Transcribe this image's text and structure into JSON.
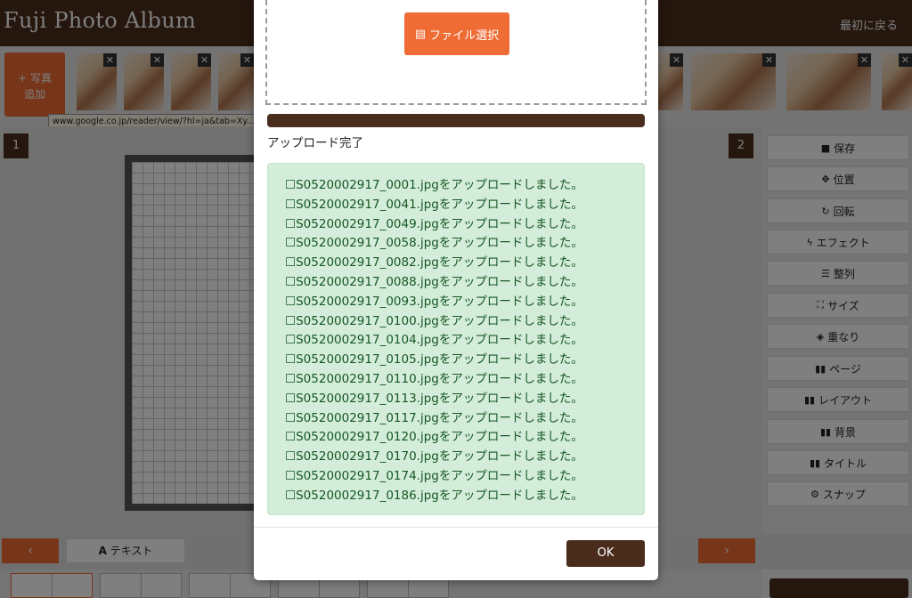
{
  "header": {
    "title": "Fuji Photo Album",
    "back_link": "最初に戻る"
  },
  "photo_strip": {
    "add_button_icon": "plus-icon",
    "add_button_line1": "写真",
    "add_button_line2": "追加",
    "tooltip": "www.google.co.jp/reader/view/?hl=ja&tab=Xy..."
  },
  "pages": {
    "left": "1",
    "right": "2"
  },
  "tools": [
    {
      "label": "保存",
      "icon": "save-icon"
    },
    {
      "label": "位置",
      "icon": "move-icon"
    },
    {
      "label": "回転",
      "icon": "rotate-icon"
    },
    {
      "label": "エフェクト",
      "icon": "bolt-icon"
    },
    {
      "label": "整列",
      "icon": "align-icon"
    },
    {
      "label": "サイズ",
      "icon": "resize-icon"
    },
    {
      "label": "重なり",
      "icon": "layers-icon"
    },
    {
      "label": "ページ",
      "icon": "book-icon"
    },
    {
      "label": "レイアウト",
      "icon": "book-icon"
    },
    {
      "label": "背景",
      "icon": "book-icon"
    },
    {
      "label": "タイトル",
      "icon": "book-icon"
    },
    {
      "label": "スナップ",
      "icon": "gear-icon"
    }
  ],
  "bottom_bar": {
    "prev": "‹",
    "next": "›",
    "text_button": "テキスト",
    "text_icon": "A"
  },
  "modal": {
    "file_select_label": "ファイル選択",
    "progress_percent": 100,
    "status": "アップロード完了",
    "messages": [
      "☐S0520002917_0001.jpgをアップロードしました。",
      "☐S0520002917_0041.jpgをアップロードしました。",
      "☐S0520002917_0049.jpgをアップロードしました。",
      "☐S0520002917_0058.jpgをアップロードしました。",
      "☐S0520002917_0082.jpgをアップロードしました。",
      "☐S0520002917_0088.jpgをアップロードしました。",
      "☐S0520002917_0093.jpgをアップロードしました。",
      "☐S0520002917_0100.jpgをアップロードしました。",
      "☐S0520002917_0104.jpgをアップロードしました。",
      "☐S0520002917_0105.jpgをアップロードしました。",
      "☐S0520002917_0110.jpgをアップロードしました。",
      "☐S0520002917_0113.jpgをアップロードしました。",
      "☐S0520002917_0117.jpgをアップロードしました。",
      "☐S0520002917_0120.jpgをアップロードしました。",
      "☐S0520002917_0170.jpgをアップロードしました。",
      "☐S0520002917_0174.jpgをアップロードしました。",
      "☐S0520002917_0186.jpgをアップロードしました。"
    ],
    "ok_label": "OK"
  },
  "colors": {
    "brand_brown": "#4a2c1c",
    "accent_orange": "#ef6c35",
    "success_bg": "#d4edda",
    "success_text": "#155724"
  }
}
